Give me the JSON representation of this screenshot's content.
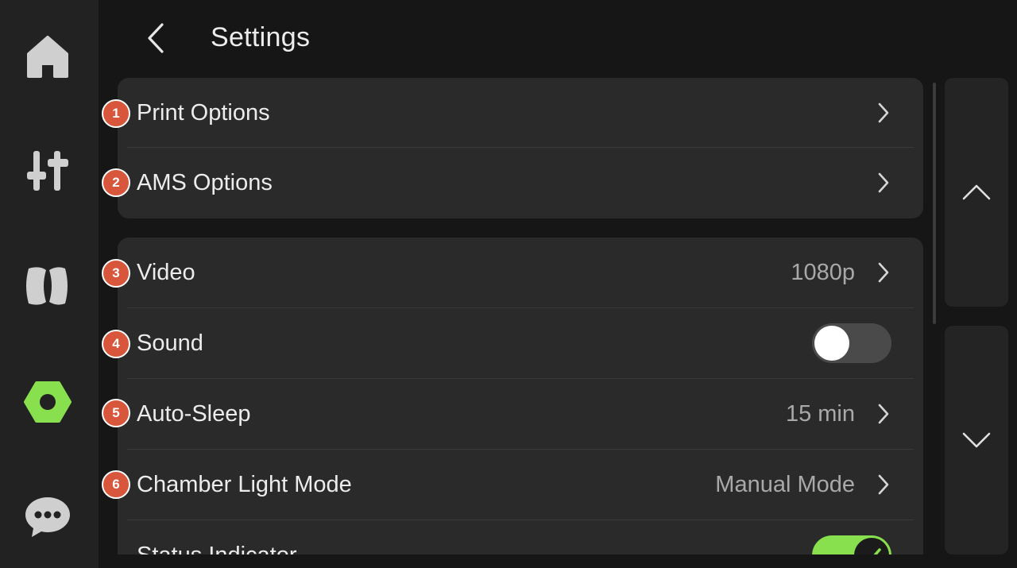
{
  "header": {
    "title": "Settings"
  },
  "sidebar": {
    "items": [
      {
        "name": "home"
      },
      {
        "name": "controls"
      },
      {
        "name": "filament"
      },
      {
        "name": "settings",
        "active": true
      },
      {
        "name": "messages"
      }
    ]
  },
  "settings": {
    "group1": [
      {
        "badge": "1",
        "label": "Print Options"
      },
      {
        "badge": "2",
        "label": "AMS Options"
      }
    ],
    "group2": [
      {
        "badge": "3",
        "label": "Video",
        "value": "1080p"
      },
      {
        "badge": "4",
        "label": "Sound",
        "toggle": "off"
      },
      {
        "badge": "5",
        "label": "Auto-Sleep",
        "value": "15 min"
      },
      {
        "badge": "6",
        "label": "Chamber Light Mode",
        "value": "Manual Mode"
      },
      {
        "label": "Status Indicator",
        "toggle": "on"
      }
    ]
  },
  "colors": {
    "accent": "#89e04e",
    "badge": "#d8563b",
    "card": "#2a2a2a",
    "background": "#161616",
    "sidebar": "#222222"
  },
  "icons": {
    "back": "chevron-left-icon",
    "row": "chevron-right-icon",
    "page_up": "chevron-up-icon",
    "page_down": "chevron-down-icon"
  }
}
